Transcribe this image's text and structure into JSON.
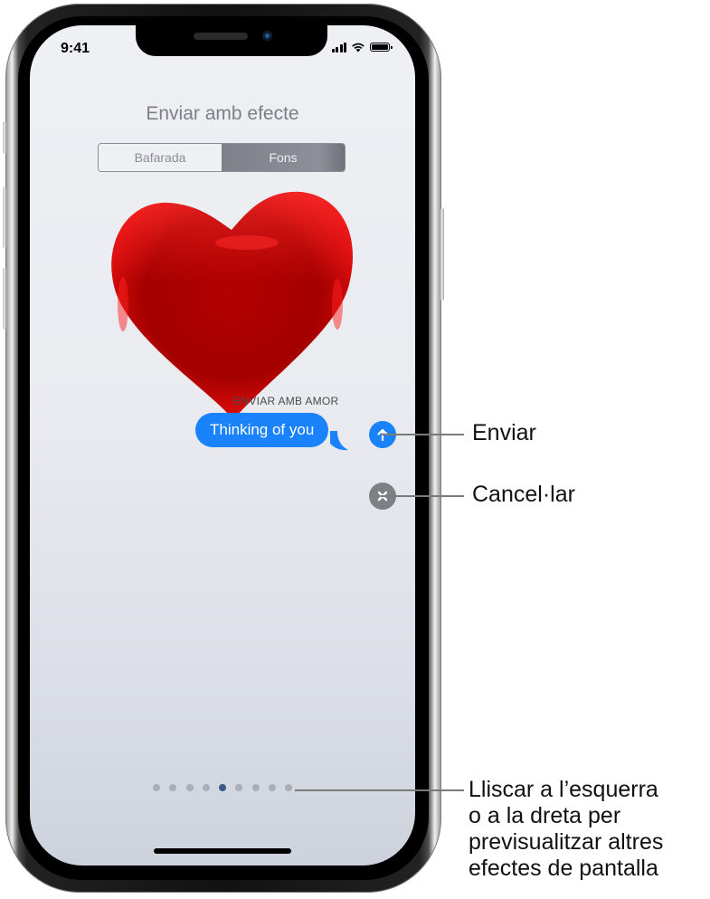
{
  "status_bar": {
    "time": "9:41",
    "icons": [
      "cellular-signal-icon",
      "wifi-icon",
      "battery-icon"
    ]
  },
  "screen": {
    "title": "Enviar amb efecte",
    "segments": [
      {
        "label": "Bafarada",
        "selected": false
      },
      {
        "label": "Fons",
        "selected": true
      }
    ],
    "effect_name": "ENVIAR AMB AMOR",
    "message_text": "Thinking of you",
    "send_icon": "arrow-up-icon",
    "cancel_icon": "close-x-icon",
    "page_indicator": {
      "total": 9,
      "current": 5
    },
    "colors": {
      "bubble": "#1a82fb",
      "heart": "#c00000",
      "cancel": "#7f8085",
      "active_dot": "#3d5a88"
    }
  },
  "callouts": {
    "send": "Enviar",
    "cancel": "Cancel·lar",
    "swipe": [
      "Lliscar a l’esquerra",
      "o a la dreta per",
      "previsualitzar altres",
      "efectes de pantalla"
    ]
  }
}
